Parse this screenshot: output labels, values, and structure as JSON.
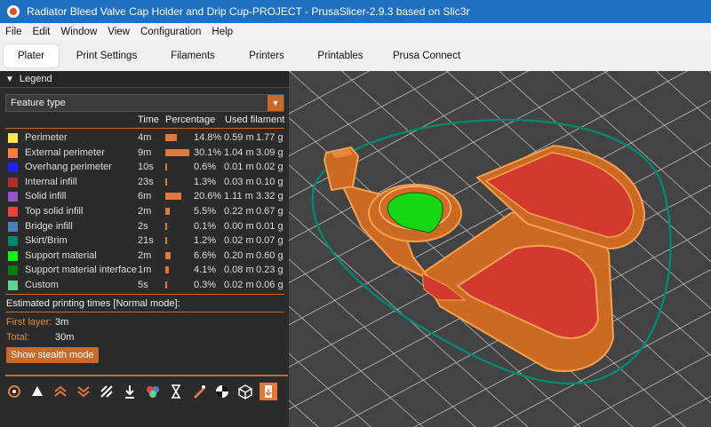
{
  "window": {
    "title": "Radiator Bleed Valve Cap Holder and Drip Cup-PROJECT - PrusaSlicer-2.9.3 based on Slic3r"
  },
  "menu": [
    "File",
    "Edit",
    "Window",
    "View",
    "Configuration",
    "Help"
  ],
  "tabs": [
    "Plater",
    "Print Settings",
    "Filaments",
    "Printers",
    "Printables",
    "Prusa Connect"
  ],
  "active_tab": "Plater",
  "legend": {
    "title": "Legend",
    "feature_type": "Feature type",
    "columns": {
      "time": "Time",
      "percentage": "Percentage",
      "used": "Used filament"
    },
    "rows": [
      {
        "name": "Perimeter",
        "color": "#ffe64d",
        "time": "4m",
        "pct": "14.8%",
        "pct_value": 14.8,
        "m": "0.59 m",
        "g": "1.77 g"
      },
      {
        "name": "External perimeter",
        "color": "#ff7d38",
        "time": "9m",
        "pct": "30.1%",
        "pct_value": 30.1,
        "m": "1.04 m",
        "g": "3.09 g"
      },
      {
        "name": "Overhang perimeter",
        "color": "#1f1fff",
        "time": "10s",
        "pct": "0.6%",
        "pct_value": 0.6,
        "m": "0.01 m",
        "g": "0.02 g"
      },
      {
        "name": "Internal infill",
        "color": "#b03029",
        "time": "23s",
        "pct": "1.3%",
        "pct_value": 1.3,
        "m": "0.03 m",
        "g": "0.10 g"
      },
      {
        "name": "Solid infill",
        "color": "#9654cc",
        "time": "6m",
        "pct": "20.6%",
        "pct_value": 20.6,
        "m": "1.11 m",
        "g": "3.32 g"
      },
      {
        "name": "Top solid infill",
        "color": "#f04040",
        "time": "2m",
        "pct": "5.5%",
        "pct_value": 5.5,
        "m": "0.22 m",
        "g": "0.67 g"
      },
      {
        "name": "Bridge infill",
        "color": "#4d80ba",
        "time": "2s",
        "pct": "0.1%",
        "pct_value": 0.1,
        "m": "0.00 m",
        "g": "0.01 g"
      },
      {
        "name": "Skirt/Brim",
        "color": "#00876e",
        "time": "21s",
        "pct": "1.2%",
        "pct_value": 1.2,
        "m": "0.02 m",
        "g": "0.07 g"
      },
      {
        "name": "Support material",
        "color": "#00ff00",
        "time": "2m",
        "pct": "6.6%",
        "pct_value": 6.6,
        "m": "0.20 m",
        "g": "0.60 g"
      },
      {
        "name": "Support material interface",
        "color": "#008000",
        "time": "1m",
        "pct": "4.1%",
        "pct_value": 4.1,
        "m": "0.08 m",
        "g": "0.23 g"
      },
      {
        "name": "Custom",
        "color": "#5ed194",
        "time": "5s",
        "pct": "0.3%",
        "pct_value": 0.3,
        "m": "0.02 m",
        "g": "0.06 g"
      }
    ],
    "estimated_label": "Estimated printing times [Normal mode]:",
    "first_layer_label": "First layer:",
    "first_layer_value": "3m",
    "total_label": "Total:",
    "total_value": "30m",
    "stealth_button": "Show stealth mode"
  },
  "toolbar_icons": [
    "seam-icon",
    "tool-marker-icon",
    "layers-up-icon",
    "layers-down-icon",
    "wipe-icon",
    "retract-icon",
    "color-change-icon",
    "pause-icon",
    "custom-gcode-icon",
    "shells-icon",
    "bounding-box-icon",
    "travel-icon"
  ],
  "accent": "#c76a2a"
}
